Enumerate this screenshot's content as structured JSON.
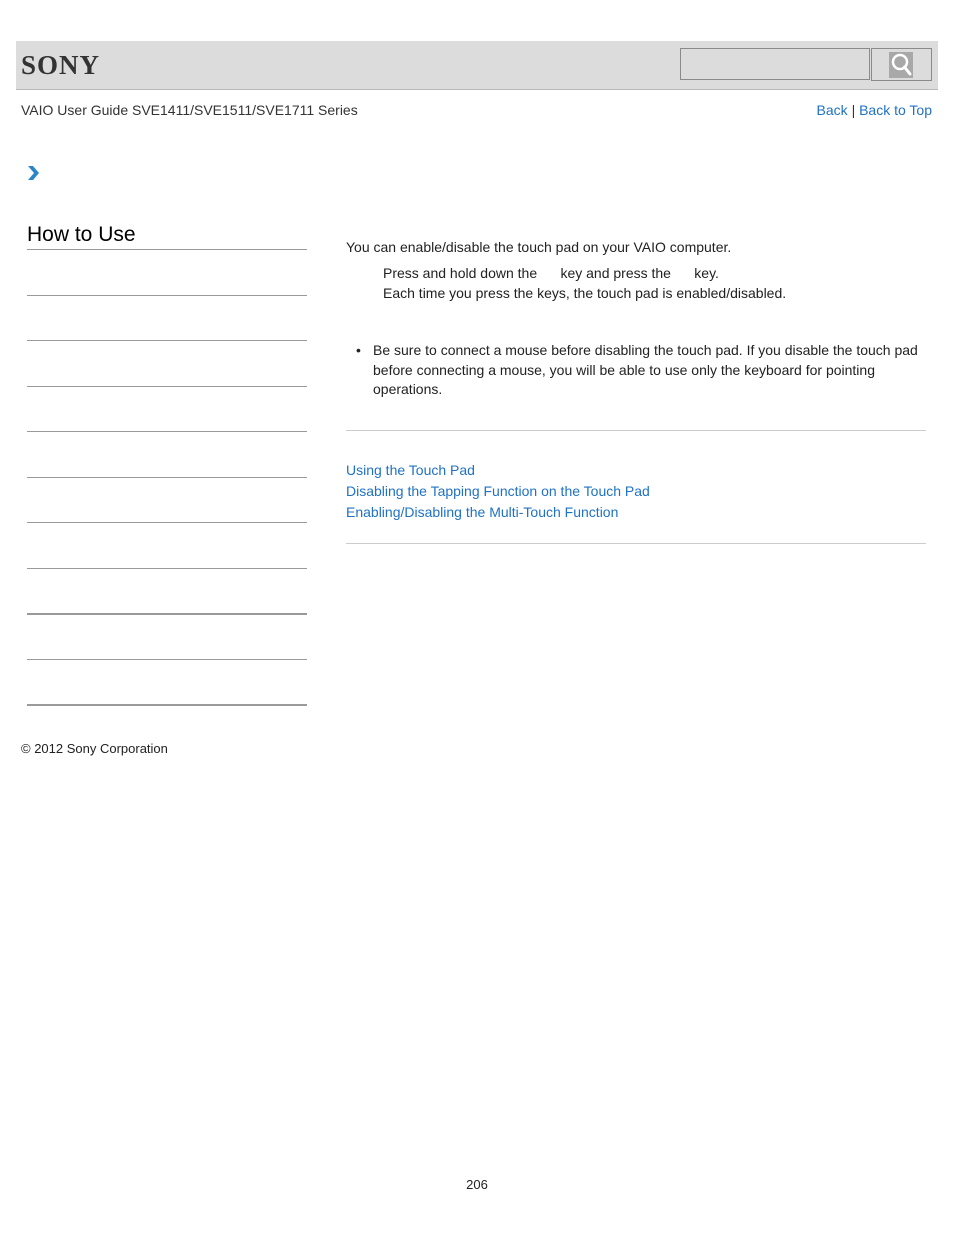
{
  "header": {
    "logo_text": "SONY",
    "search": {
      "placeholder": "",
      "value": "",
      "button_icon": "search-icon"
    }
  },
  "subheader": {
    "guide_title": "VAIO User Guide SVE1411/SVE1511/SVE1711 Series",
    "back_label": "Back",
    "separator": "|",
    "back_to_top_label": "Back to Top"
  },
  "breadcrumb": {
    "icon": "chevron-right-icon"
  },
  "sidebar": {
    "title": "How to Use",
    "items": [
      "",
      "",
      "",
      "",
      "",
      "",
      "",
      "",
      "",
      "",
      ""
    ]
  },
  "main": {
    "intro": "You can enable/disable the touch pad on your VAIO computer.",
    "step_line_1": "Press and hold down the      key and press the      key.",
    "step_line_2": "Each time you press the keys, the touch pad is enabled/disabled.",
    "note_bullet": "•",
    "note_text": "Be sure to connect a mouse before disabling the touch pad. If you disable the touch pad before connecting a mouse, you will be able to use only the keyboard for pointing operations.",
    "related_links": [
      "Using the Touch Pad",
      "Disabling the Tapping Function on the Touch Pad",
      "Enabling/Disabling the Multi-Touch Function"
    ]
  },
  "footer": {
    "copyright": "© 2012 Sony Corporation",
    "page_number": "206"
  },
  "colors": {
    "link": "#1f72c4",
    "header_bg": "#dcdcdc",
    "chevron": "#2a86c8"
  }
}
